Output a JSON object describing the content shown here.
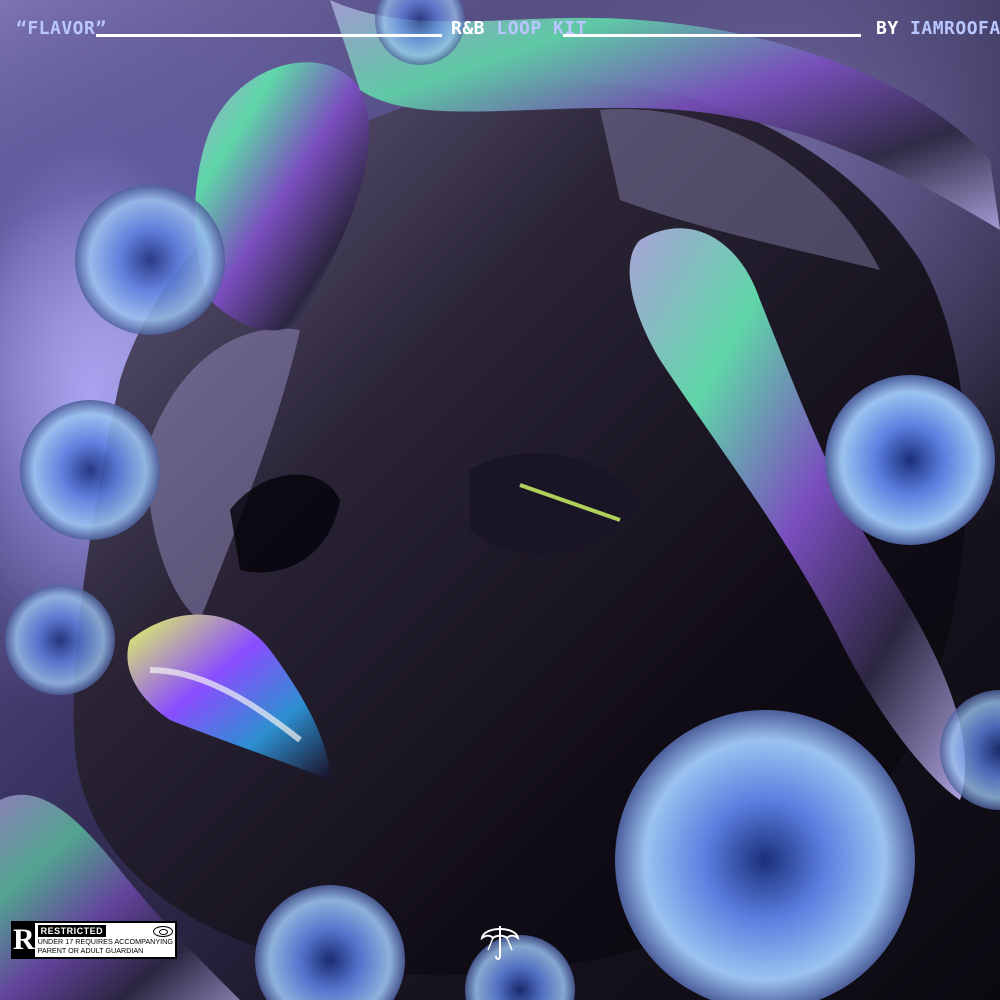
{
  "cover": {
    "title": "“FLAVOR”",
    "kit": {
      "prefix": "R&B",
      "suffix": "LOOP KIT"
    },
    "artist": {
      "prefix": "BY",
      "name": "IAMROOFA"
    },
    "rating": {
      "letter": "R",
      "title": "RESTRICTED",
      "line1": "UNDER 17 REQUIRES ACCOMPANYING",
      "line2": "PARENT OR ADULT GUARDIAN"
    },
    "logo_icon": "umbrella-logo-icon"
  },
  "colors": {
    "accent": "#b9c6ff",
    "text": "#ffffff",
    "background_dark": "#0b0910",
    "iridescent_green": "#c8ff3c",
    "iridescent_magenta": "#c86cff",
    "flower_blue": "#6f93e6"
  }
}
